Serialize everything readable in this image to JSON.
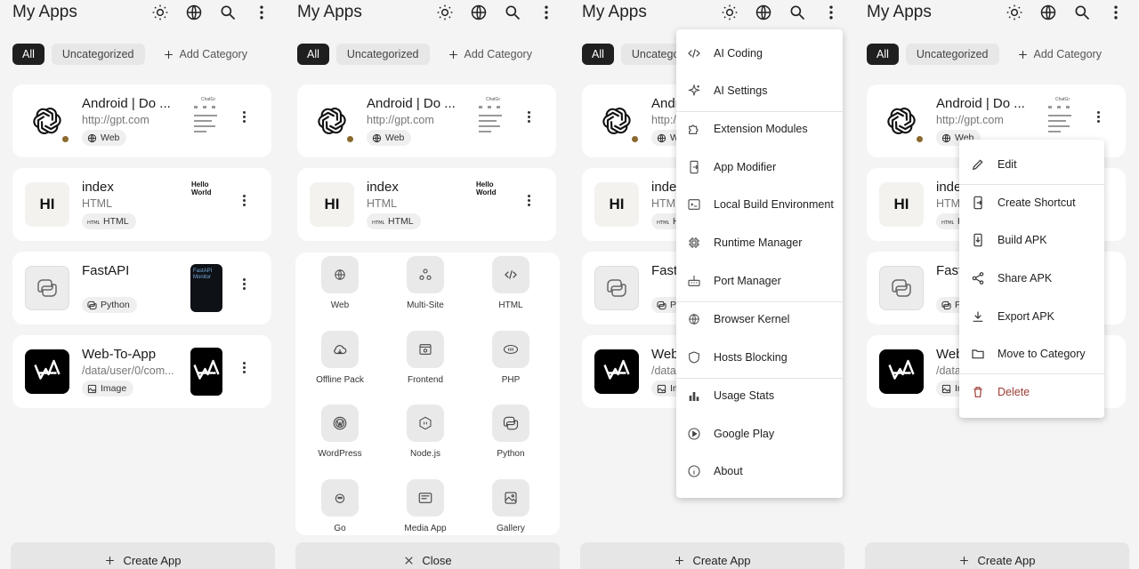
{
  "title": "My Apps",
  "chips": {
    "all": "All",
    "uncategorized": "Uncategorized",
    "add_category": "Add Category"
  },
  "cards": [
    {
      "name": "Android | Do ...",
      "url": "http://gpt.com",
      "tag": "Web",
      "preview_text": "ChatGr"
    },
    {
      "name": "index",
      "url": "HTML",
      "tag": "HTML",
      "preview_text": "Hello World"
    },
    {
      "name": "FastAPI",
      "url": "",
      "tag": "Python",
      "preview_text": "FastAPI Monitor"
    },
    {
      "name": "Web-To-App",
      "url": "/data/user/0/com...",
      "tag": "Image",
      "preview_text": ""
    }
  ],
  "create_app": "Create App",
  "close": "Close",
  "hi_text": "HI",
  "app_types": [
    {
      "label": "Web",
      "icon": "globe-icon"
    },
    {
      "label": "Multi-Site",
      "icon": "multi-site-icon"
    },
    {
      "label": "HTML",
      "icon": "code-icon"
    },
    {
      "label": "Offline Pack",
      "icon": "cloud-icon"
    },
    {
      "label": "Frontend",
      "icon": "frontend-icon"
    },
    {
      "label": "PHP",
      "icon": "php-icon"
    },
    {
      "label": "WordPress",
      "icon": "wordpress-icon"
    },
    {
      "label": "Node.js",
      "icon": "nodejs-icon"
    },
    {
      "label": "Python",
      "icon": "python-icon"
    },
    {
      "label": "Go",
      "icon": "go-icon"
    },
    {
      "label": "Media App",
      "icon": "media-icon"
    },
    {
      "label": "Gallery",
      "icon": "gallery-icon"
    }
  ],
  "overflow_menu": [
    {
      "label": "AI Coding",
      "icon": "code-icon"
    },
    {
      "label": "AI Settings",
      "icon": "sparkle-icon"
    },
    {
      "label": "Extension Modules",
      "icon": "puzzle-icon"
    },
    {
      "label": "App Modifier",
      "icon": "app-modifier-icon"
    },
    {
      "label": "Local Build Environment",
      "icon": "terminal-icon"
    },
    {
      "label": "Runtime Manager",
      "icon": "chip-icon"
    },
    {
      "label": "Port Manager",
      "icon": "port-icon"
    },
    {
      "label": "Browser Kernel",
      "icon": "globe-icon"
    },
    {
      "label": "Hosts Blocking",
      "icon": "shield-icon"
    },
    {
      "label": "Usage Stats",
      "icon": "bar-chart-icon"
    },
    {
      "label": "Google Play",
      "icon": "play-icon"
    },
    {
      "label": "About",
      "icon": "info-icon"
    }
  ],
  "context_menu": [
    {
      "label": "Edit",
      "icon": "pencil-icon"
    },
    {
      "label": "Create Shortcut",
      "icon": "shortcut-icon"
    },
    {
      "label": "Build APK",
      "icon": "build-icon"
    },
    {
      "label": "Share APK",
      "icon": "share-icon"
    },
    {
      "label": "Export APK",
      "icon": "download-icon"
    },
    {
      "label": "Move to Category",
      "icon": "folder-icon"
    },
    {
      "label": "Delete",
      "icon": "trash-icon"
    }
  ],
  "colors": {
    "background": "#f4f4f4",
    "chip_selected": "#1f1f1f",
    "status_dot": "#8a6a2e",
    "delete": "#9a3c32"
  }
}
